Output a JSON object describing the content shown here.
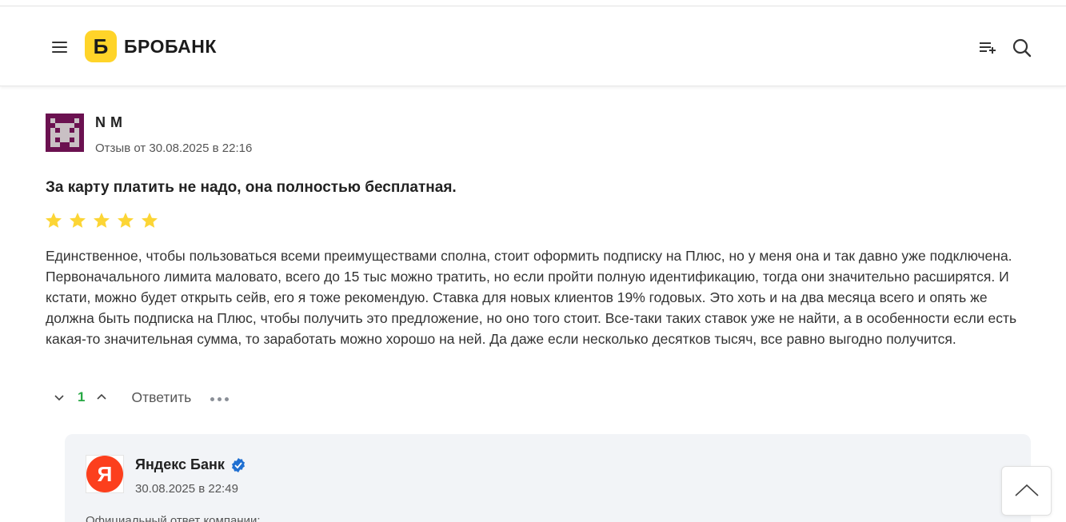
{
  "header": {
    "logo_letter": "Б",
    "logo_text": "БРОБАНК",
    "icons": [
      "menu-icon",
      "playlist-add-icon",
      "search-icon"
    ],
    "brand_color": "#ffd429"
  },
  "review": {
    "author": "N M",
    "date": "Отзыв от 30.08.2025 в 22:16",
    "title": "За карту платить не надо, она полностью бесплатная.",
    "rating": 5,
    "rating_max": 5,
    "star_color": "#fcd535",
    "text": "Единственное, чтобы пользоваться всеми преимуществами сполна, стоит оформить подписку на Плюс, но у меня она и так давно уже подключена. Первоначального лимита маловато, всего до 15 тыс можно тратить, но если пройти полную идентификацию, тогда они значительно расширятся. И кстати, можно будет открыть сейв, его я тоже рекомендую. Ставка для новых клиентов 19% годовых. Это хоть и на два месяца всего и опять же должна быть подписка на Плюс, чтобы получить это предложение, но оно того стоит. Все-таки таких ставок уже не найти, а в особенности если есть какая-то значительная сумма, то заработать можно хорошо на ней. Да даже если несколько десятков тысяч, все равно выгодно получится.",
    "vote_count": "1",
    "reply_label": "Ответить",
    "vote_color": "#27a844"
  },
  "company_reply": {
    "logo_letter": "Я",
    "name": "Яндекс Банк",
    "date": "30.08.2025 в 22:49",
    "note": "Официальный ответ компании:",
    "logo_color": "#fc3f1d",
    "verified_color": "#1f6fd1"
  }
}
